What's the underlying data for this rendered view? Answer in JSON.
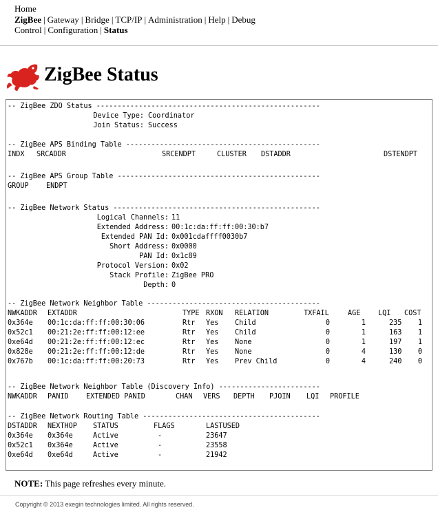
{
  "nav": {
    "row1": [
      "Home"
    ],
    "row2": [
      "ZigBee",
      "Gateway",
      "Bridge",
      "TCP/IP",
      "Administration",
      "Help",
      "Debug"
    ],
    "row3": [
      "Control",
      "Configuration",
      "Status"
    ],
    "current_top": "ZigBee",
    "current_sub": "Status"
  },
  "header": {
    "title": "ZigBee Status",
    "logo_icon": "red-gecko-logo-icon"
  },
  "zdo": {
    "heading": "-- ZigBee ZDO Status -----------------------------------------------------",
    "device_type_label": "Device Type:",
    "device_type": "Coordinator",
    "join_status_label": "Join Status:",
    "join_status": "Success"
  },
  "binding": {
    "heading": "-- ZigBee APS Binding Table ----------------------------------------------",
    "columns": [
      "INDX",
      "SRCADDR",
      "SRCENDPT",
      "CLUSTER",
      "DSTADDR",
      "DSTENDPT"
    ]
  },
  "group": {
    "heading": "-- ZigBee APS Group Table ------------------------------------------------",
    "columns": [
      "GROUP",
      "ENDPT"
    ]
  },
  "network": {
    "heading": "-- ZigBee Network Status -------------------------------------------------",
    "fields": [
      {
        "label": "Logical Channels:",
        "value": "11"
      },
      {
        "label": "Extended Address:",
        "value": "00:1c:da:ff:ff:00:30:b7"
      },
      {
        "label": "Extended PAN Id:",
        "value": "0x001cdaffff0030b7"
      },
      {
        "label": "Short Address:",
        "value": "0x0000"
      },
      {
        "label": "PAN Id:",
        "value": "0x1c89"
      },
      {
        "label": "Protocol Version:",
        "value": "0x02"
      },
      {
        "label": "Stack Profile:",
        "value": "ZigBee PRO"
      },
      {
        "label": "Depth:",
        "value": "0"
      }
    ]
  },
  "neighbor": {
    "heading": "-- ZigBee Network Neighbor Table -----------------------------------------",
    "columns": [
      "NWKADDR",
      "EXTADDR",
      "TYPE",
      "RXON",
      "RELATION",
      "TXFAIL",
      "AGE",
      "LQI",
      "COST"
    ],
    "rows": [
      [
        "0x364e",
        "00:1c:da:ff:ff:00:30:06",
        "Rtr",
        "Yes",
        "Child",
        "0",
        "1",
        "235",
        "1"
      ],
      [
        "0x52c1",
        "00:21:2e:ff:ff:00:12:ee",
        "Rtr",
        "Yes",
        "Child",
        "0",
        "1",
        "163",
        "1"
      ],
      [
        "0xe64d",
        "00:21:2e:ff:ff:00:12:ec",
        "Rtr",
        "Yes",
        "None",
        "0",
        "1",
        "197",
        "1"
      ],
      [
        "0x828e",
        "00:21:2e:ff:ff:00:12:de",
        "Rtr",
        "Yes",
        "None",
        "0",
        "4",
        "130",
        "0"
      ],
      [
        "0x767b",
        "00:1c:da:ff:ff:00:20:73",
        "Rtr",
        "Yes",
        "Prev Child",
        "0",
        "4",
        "240",
        "0"
      ]
    ]
  },
  "discovery": {
    "heading": "-- ZigBee Network Neighbor Table (Discovery Info) ------------------------",
    "columns": [
      "NWKADDR",
      "PANID",
      "EXTENDED PANID",
      "CHAN",
      "VERS",
      "DEPTH",
      "PJOIN",
      "LQI",
      "PROFILE"
    ]
  },
  "routing": {
    "heading": "-- ZigBee Network Routing Table ------------------------------------------",
    "columns": [
      "DSTADDR",
      "NEXTHOP",
      "STATUS",
      "FLAGS",
      "LASTUSED"
    ],
    "rows": [
      [
        "0x364e",
        "0x364e",
        "Active",
        "-",
        "23647"
      ],
      [
        "0x52c1",
        "0x364e",
        "Active",
        "-",
        "23558"
      ],
      [
        "0xe64d",
        "0xe64d",
        "Active",
        "-",
        "21942"
      ]
    ]
  },
  "note": {
    "label": "NOTE:",
    "text": "This page refreshes every minute."
  },
  "footer": {
    "copyright": "Copyright © 2013 exegin technologies limited. All rights reserved."
  }
}
